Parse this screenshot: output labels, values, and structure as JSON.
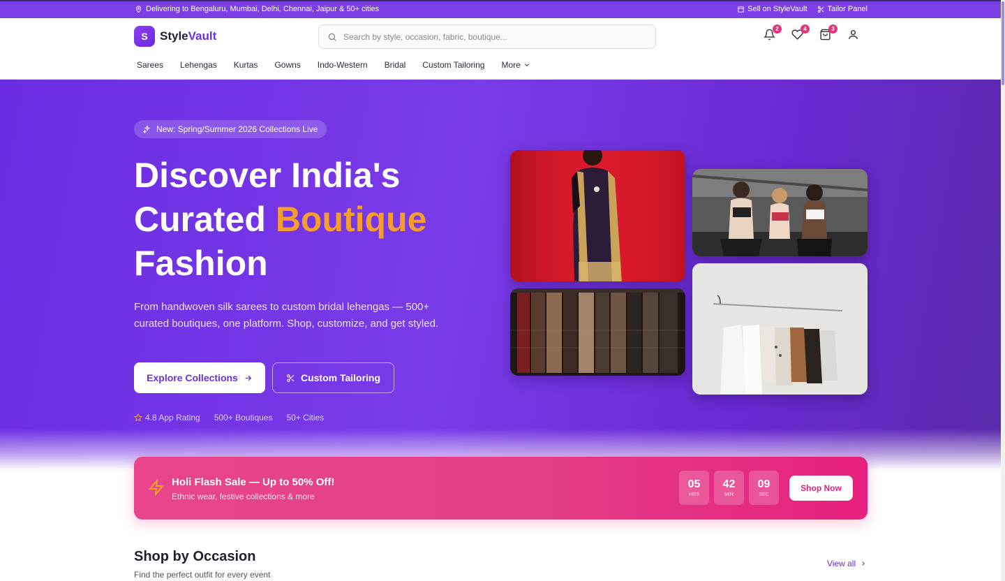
{
  "topbar": {
    "delivery": "Delivering to Bengaluru, Mumbai, Delhi, Chennai, Jaipur & 50+ cities",
    "sell": "Sell on StyleVault",
    "tailor": "Tailor Panel"
  },
  "header": {
    "logo_letter": "S",
    "logo_text_a": "Style",
    "logo_text_b": "Vault",
    "search_placeholder": "Search by style, occasion, fabric, boutique...",
    "badges": {
      "notifications": "2",
      "wishlist": "4",
      "cart": "3"
    }
  },
  "nav": {
    "items": [
      "Sarees",
      "Lehengas",
      "Kurtas",
      "Gowns",
      "Indo-Western",
      "Bridal",
      "Custom Tailoring"
    ],
    "more": "More"
  },
  "hero": {
    "pill": "New: Spring/Summer 2026 Collections Live",
    "title_line1": "Discover India's",
    "title_line2_a": "Curated ",
    "title_line2_b": "Boutique",
    "title_line3": "Fashion",
    "subtitle": "From handwoven silk sarees to custom bridal lehengas — 500+ curated boutiques, one platform. Shop, customize, and get styled.",
    "primary_button": "Explore Collections",
    "secondary_button": "Custom Tailoring",
    "stats": [
      "4.8 App Rating",
      "500+ Boutiques",
      "50+ Cities"
    ]
  },
  "flash_sale": {
    "title": "Holi Flash Sale — Up to 50% Off!",
    "subtitle": "Ethnic wear, festive collections & more",
    "timer": [
      {
        "value": "05",
        "unit": "HRS"
      },
      {
        "value": "42",
        "unit": "MIN"
      },
      {
        "value": "09",
        "unit": "SEC"
      }
    ],
    "button": "Shop Now"
  },
  "occasion": {
    "title": "Shop by Occasion",
    "subtitle": "Find the perfect outfit for every event",
    "view_all": "View all"
  },
  "colors": {
    "brand": "#6d2fe3",
    "accent": "#f59e2e",
    "sale": "#e6207e"
  }
}
